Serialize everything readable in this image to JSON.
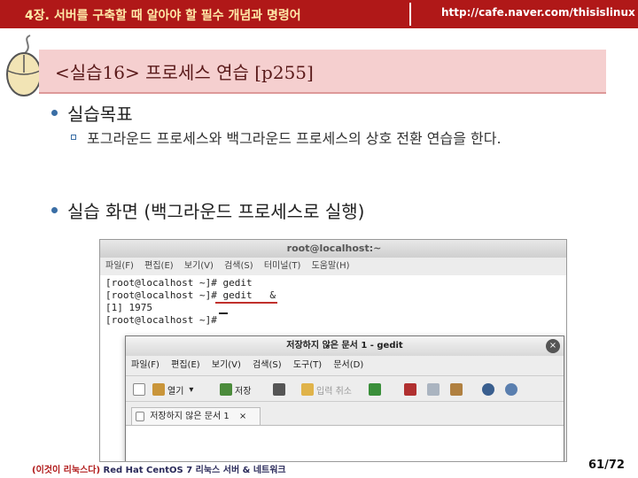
{
  "header": {
    "chapter_title": "4장. 서버를 구축할 때 알아야 할 필수 개념과 명령어",
    "url": "http://cafe.naver.com/thisislinux"
  },
  "slide": {
    "title": "<실습16> 프로세스 연습 [p255]",
    "bullets": [
      {
        "text": "실습목표",
        "sub": "포그라운드 프로세스와 백그라운드 프로세스의 상호 전환 연습을 한다."
      },
      {
        "text": "실습 화면 (백그라운드 프로세스로 실행)"
      }
    ]
  },
  "terminal": {
    "title": "root@localhost:~",
    "menu": [
      "파일(F)",
      "편집(E)",
      "보기(V)",
      "검색(S)",
      "터미널(T)",
      "도움말(H)"
    ],
    "lines": [
      "[root@localhost ~]# gedit",
      "[root@localhost ~]# gedit   &",
      "[1] 1975",
      "[root@localhost ~]# "
    ]
  },
  "gedit": {
    "title": "저장하지 않은 문서 1 - gedit",
    "close_glyph": "×",
    "menu": [
      "파일(F)",
      "편집(E)",
      "보기(V)",
      "검색(S)",
      "도구(T)",
      "문서(D)"
    ],
    "toolbar": {
      "open_label": "열기",
      "save_label": "저장",
      "undo_label": "입력 취소",
      "dropdown_glyph": "▾"
    },
    "tab_label": "저장하지 않은 문서 1",
    "tab_close_glyph": "×"
  },
  "footer": {
    "book_highlight": "(이것이 리눅스다)",
    "book_rest": " Red Hat CentOS 7 리눅스 서버 & 네트워크",
    "page": "61/72"
  },
  "colors": {
    "header_bg": "#b01818",
    "title_band": "#f5cfcf",
    "bullet": "#3a6ea5",
    "annotation_underline": "#c0302c"
  }
}
